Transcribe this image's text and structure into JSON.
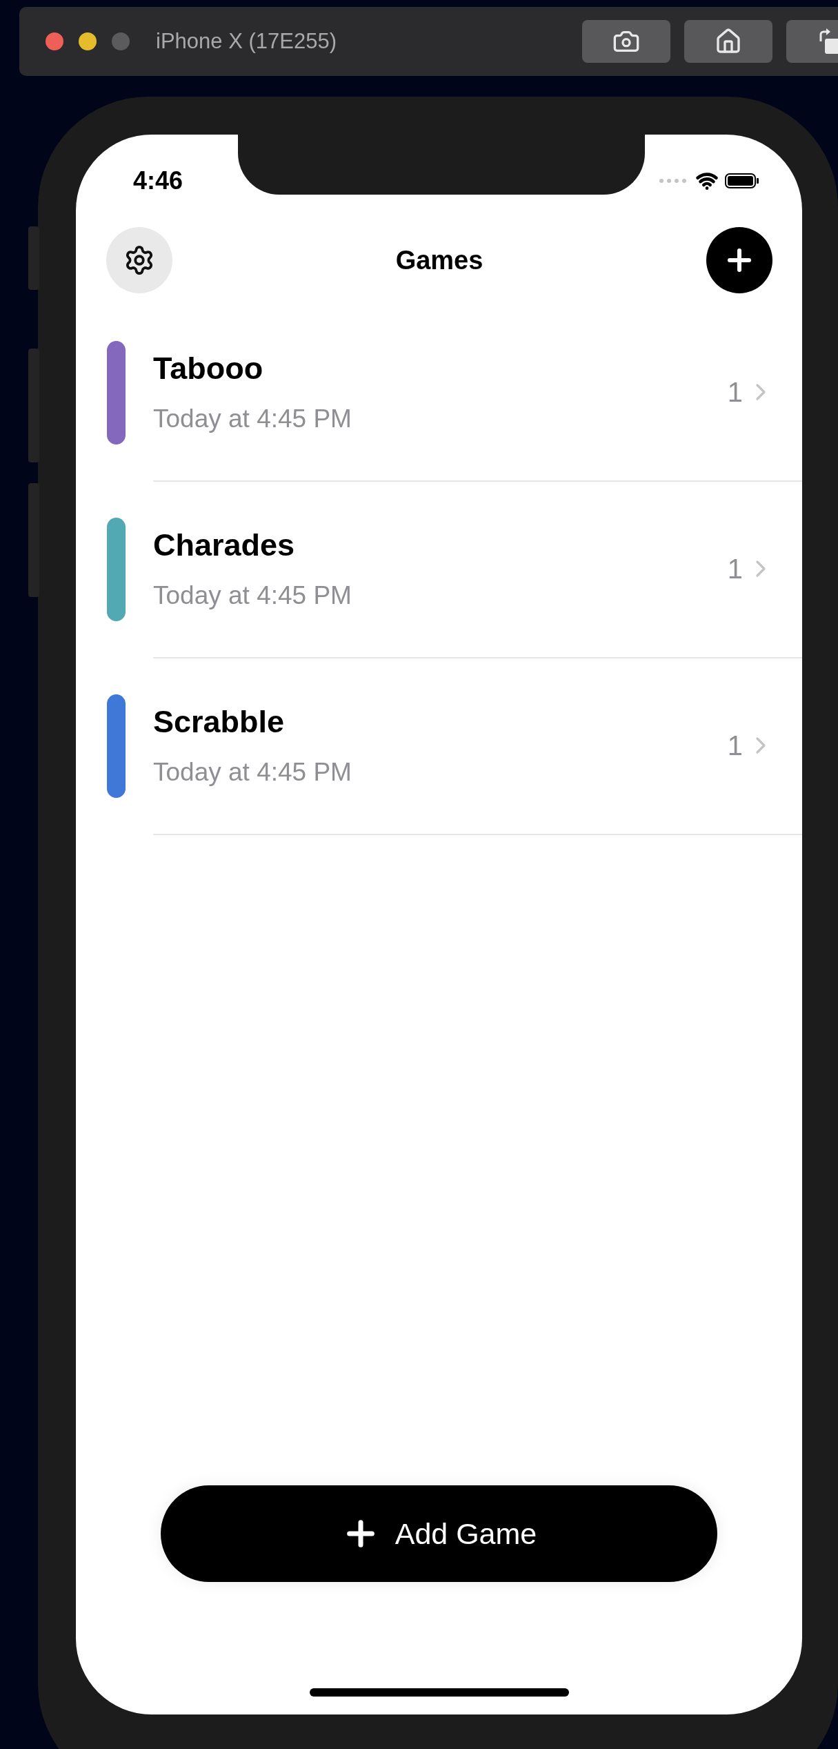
{
  "simulator": {
    "title": "iPhone X (17E255)"
  },
  "status_bar": {
    "time": "4:46"
  },
  "nav": {
    "title": "Games"
  },
  "games": [
    {
      "name": "Tabooo",
      "date": "Today at 4:45 PM",
      "count": "1",
      "color": "#8468be"
    },
    {
      "name": "Charades",
      "date": "Today at 4:45 PM",
      "count": "1",
      "color": "#52a9b4"
    },
    {
      "name": "Scrabble",
      "date": "Today at 4:45 PM",
      "count": "1",
      "color": "#3f78d6"
    }
  ],
  "add_button": {
    "label": "Add Game"
  }
}
